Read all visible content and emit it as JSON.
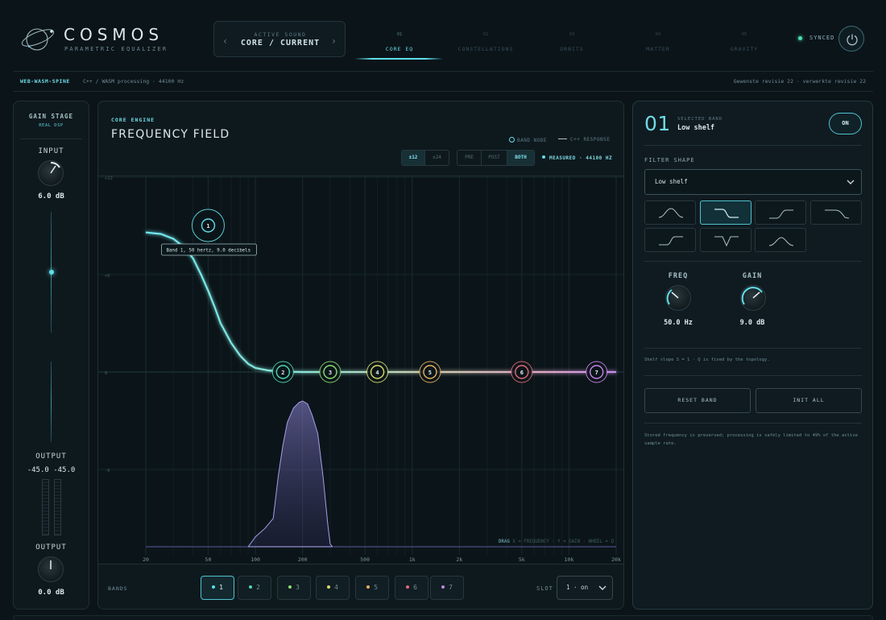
{
  "app": {
    "title": "COSMOS",
    "subtitle": "PARAMETRIC EQUALIZER"
  },
  "active_sound": {
    "label": "ACTIVE SOUND",
    "value": "CORE / CURRENT",
    "prev_icon": "chevron-left-icon",
    "next_icon": "chevron-right-icon"
  },
  "nav": {
    "tabs": [
      {
        "num": "01",
        "label": "CORE EQ",
        "active": true
      },
      {
        "num": "02",
        "label": "CONSTELLATIONS",
        "active": false
      },
      {
        "num": "03",
        "label": "ORBITS",
        "active": false
      },
      {
        "num": "04",
        "label": "MATTER",
        "active": false
      },
      {
        "num": "05",
        "label": "GRAVITY",
        "active": false
      }
    ]
  },
  "status": {
    "synced": "SYNCED",
    "power_icon": "power-icon"
  },
  "subbar": {
    "tag": "WEB-WASM-SPINE",
    "info": "C++ / WASM processing · 44100 Hz",
    "revision": "Gewenste revisie 22 · verwerkte revisie 22"
  },
  "gain_stage": {
    "title": "GAIN STAGE",
    "subtitle": "REAL DSP",
    "input_label": "INPUT",
    "input_value": "6.0 dB",
    "input_slider_level": 0.5,
    "output_label": "OUTPUT",
    "meter_values": [
      "-45.0",
      "-45.0"
    ],
    "output_knob_label": "OUTPUT",
    "output_value": "0.0 dB"
  },
  "core": {
    "label": "CORE ENGINE",
    "title": "FREQUENCY FIELD",
    "legend_node": "BAND NODE",
    "legend_response": "C++ RESPONSE",
    "range_options": [
      "±12",
      "±24"
    ],
    "range_selected": "±12",
    "view_options": [
      "PRE",
      "POST",
      "BOTH"
    ],
    "view_selected": "BOTH",
    "measured": "MEASURED · 44100 HZ"
  },
  "chart_data": {
    "type": "line",
    "title": "",
    "xlabel": "",
    "ylabel": "",
    "x_scale": "log",
    "xlim": [
      20,
      20000
    ],
    "ylim": [
      -12,
      12
    ],
    "x_ticks": [
      20,
      50,
      100,
      200,
      500,
      1000,
      2000,
      5000,
      10000,
      20000
    ],
    "x_tick_labels": [
      "20",
      "50",
      "100",
      "200",
      "500",
      "1k",
      "2k",
      "5k",
      "10k",
      "20k"
    ],
    "y_ticks": [
      12,
      6,
      0,
      -6,
      -12
    ],
    "y_tick_labels": [
      "+12",
      "+6",
      "0",
      "-6",
      "-12"
    ],
    "grid": true,
    "response": {
      "name": "C++ RESPONSE",
      "x": [
        20,
        25,
        30,
        35,
        40,
        45,
        50,
        55,
        60,
        70,
        80,
        90,
        100,
        120,
        150,
        200,
        300,
        500,
        1000,
        2000,
        5000,
        10000,
        20000
      ],
      "y": [
        8.6,
        8.5,
        8.2,
        7.7,
        7.0,
        6.0,
        5.0,
        4.0,
        3.0,
        1.8,
        1.0,
        0.5,
        0.25,
        0.1,
        0.02,
        0,
        0,
        0,
        0,
        0,
        0,
        0,
        0
      ]
    },
    "spectrum": {
      "name": "MEASURED",
      "x": [
        90,
        100,
        115,
        130,
        140,
        150,
        160,
        175,
        190,
        200,
        215,
        230,
        250,
        270,
        290,
        300,
        310
      ],
      "y": [
        -12,
        -11.3,
        -10.7,
        -10.0,
        -7.0,
        -4.8,
        -3.2,
        -2.2,
        -1.8,
        -1.7,
        -1.9,
        -2.7,
        -4.0,
        -7.0,
        -10.5,
        -11.8,
        -12
      ]
    },
    "bands": [
      {
        "id": "1",
        "freq": 50,
        "gain": 9.0,
        "color": "#5ee0ea"
      },
      {
        "id": "2",
        "freq": 150,
        "gain": 0,
        "color": "#4ed8b4"
      },
      {
        "id": "3",
        "freq": 300,
        "gain": 0,
        "color": "#8cdc74"
      },
      {
        "id": "4",
        "freq": 600,
        "gain": 0,
        "color": "#d8dc6a"
      },
      {
        "id": "5",
        "freq": 1300,
        "gain": 0,
        "color": "#e8b060"
      },
      {
        "id": "6",
        "freq": 5000,
        "gain": 0,
        "color": "#e06a7a"
      },
      {
        "id": "7",
        "freq": 15000,
        "gain": 0,
        "color": "#c584e8"
      }
    ],
    "tooltip": "Band 1, 50 hertz, 9.0 decibels",
    "hint": "DRAG X = FREQUENCY · Y = GAIN · WHEEL = Q",
    "hint_prefix": "DRAG",
    "hint_rest": "X = FREQUENCY · Y = GAIN · WHEEL = Q"
  },
  "bands_bar": {
    "label": "BANDS",
    "items": [
      {
        "label": "1",
        "color": "#5ee0ea",
        "active": true
      },
      {
        "label": "2",
        "color": "#4ed8b4",
        "active": false
      },
      {
        "label": "3",
        "color": "#8cdc74",
        "active": false
      },
      {
        "label": "4",
        "color": "#d8dc6a",
        "active": false
      },
      {
        "label": "5",
        "color": "#e8b060",
        "active": false
      },
      {
        "label": "6",
        "color": "#e06a7a",
        "active": false
      },
      {
        "label": "7",
        "color": "#c584e8",
        "active": false
      }
    ],
    "slot_label": "SLOT",
    "slot_value": "1 · on"
  },
  "selected_band": {
    "number": "01",
    "label": "SELECTED BAND",
    "name": "Low shelf",
    "on_label": "ON",
    "filter_shape_label": "FILTER SHAPE",
    "filter_shape_value": "Low shelf",
    "shapes": [
      "bell-shape-icon",
      "low-shelf-shape-icon",
      "high-pass-shape-icon",
      "low-pass-shape-icon",
      "high-shelf-shape-icon",
      "notch-shape-icon",
      "band-pass-shape-icon"
    ],
    "freq_label": "FREQ",
    "freq_value": "50.0 Hz",
    "gain_label": "GAIN",
    "gain_value": "9.0 dB",
    "slope_note": "Shelf slope S = 1 · Q is fixed by the topology.",
    "reset_label": "RESET BAND",
    "init_label": "INIT ALL",
    "stored_note": "Stored frequency is preserved; processing is safely limited to 49% of the active sample rate."
  },
  "colors": {
    "accent": "#5ee0ea",
    "background": "#0b1419",
    "panel": "#0e191e",
    "spectrum": "#8f86d8"
  }
}
